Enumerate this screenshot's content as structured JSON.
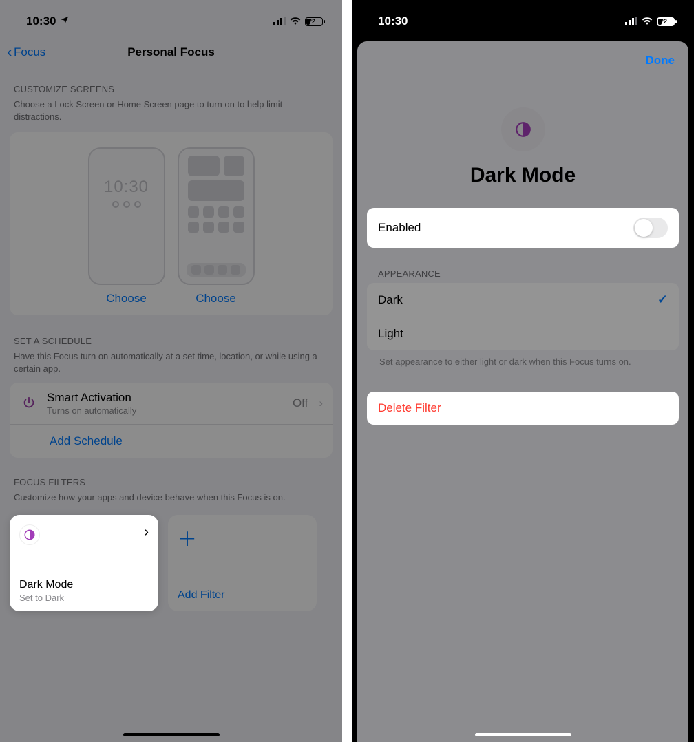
{
  "status": {
    "time": "10:30",
    "battery_pct": "22",
    "battery_fill_pct": 22
  },
  "left": {
    "back_label": "Focus",
    "title": "Personal Focus",
    "customize": {
      "header": "CUSTOMIZE SCREENS",
      "desc": "Choose a Lock Screen or Home Screen page to turn on to help limit distractions.",
      "lock_time": "10:30",
      "choose": "Choose"
    },
    "schedule": {
      "header": "SET A SCHEDULE",
      "desc": "Have this Focus turn on automatically at a set time, location, or while using a certain app.",
      "smart_title": "Smart Activation",
      "smart_sub": "Turns on automatically",
      "smart_value": "Off",
      "add": "Add Schedule"
    },
    "filters": {
      "header": "FOCUS FILTERS",
      "desc": "Customize how your apps and device behave when this Focus is on.",
      "card_title": "Dark Mode",
      "card_sub": "Set to Dark",
      "add": "Add Filter"
    }
  },
  "right": {
    "done": "Done",
    "hero_title": "Dark Mode",
    "enabled_label": "Enabled",
    "enabled_on": false,
    "appearance_header": "APPEARANCE",
    "options": [
      "Dark",
      "Light"
    ],
    "selected": "Dark",
    "footer": "Set appearance to either light or dark when this Focus turns on.",
    "delete": "Delete Filter"
  }
}
